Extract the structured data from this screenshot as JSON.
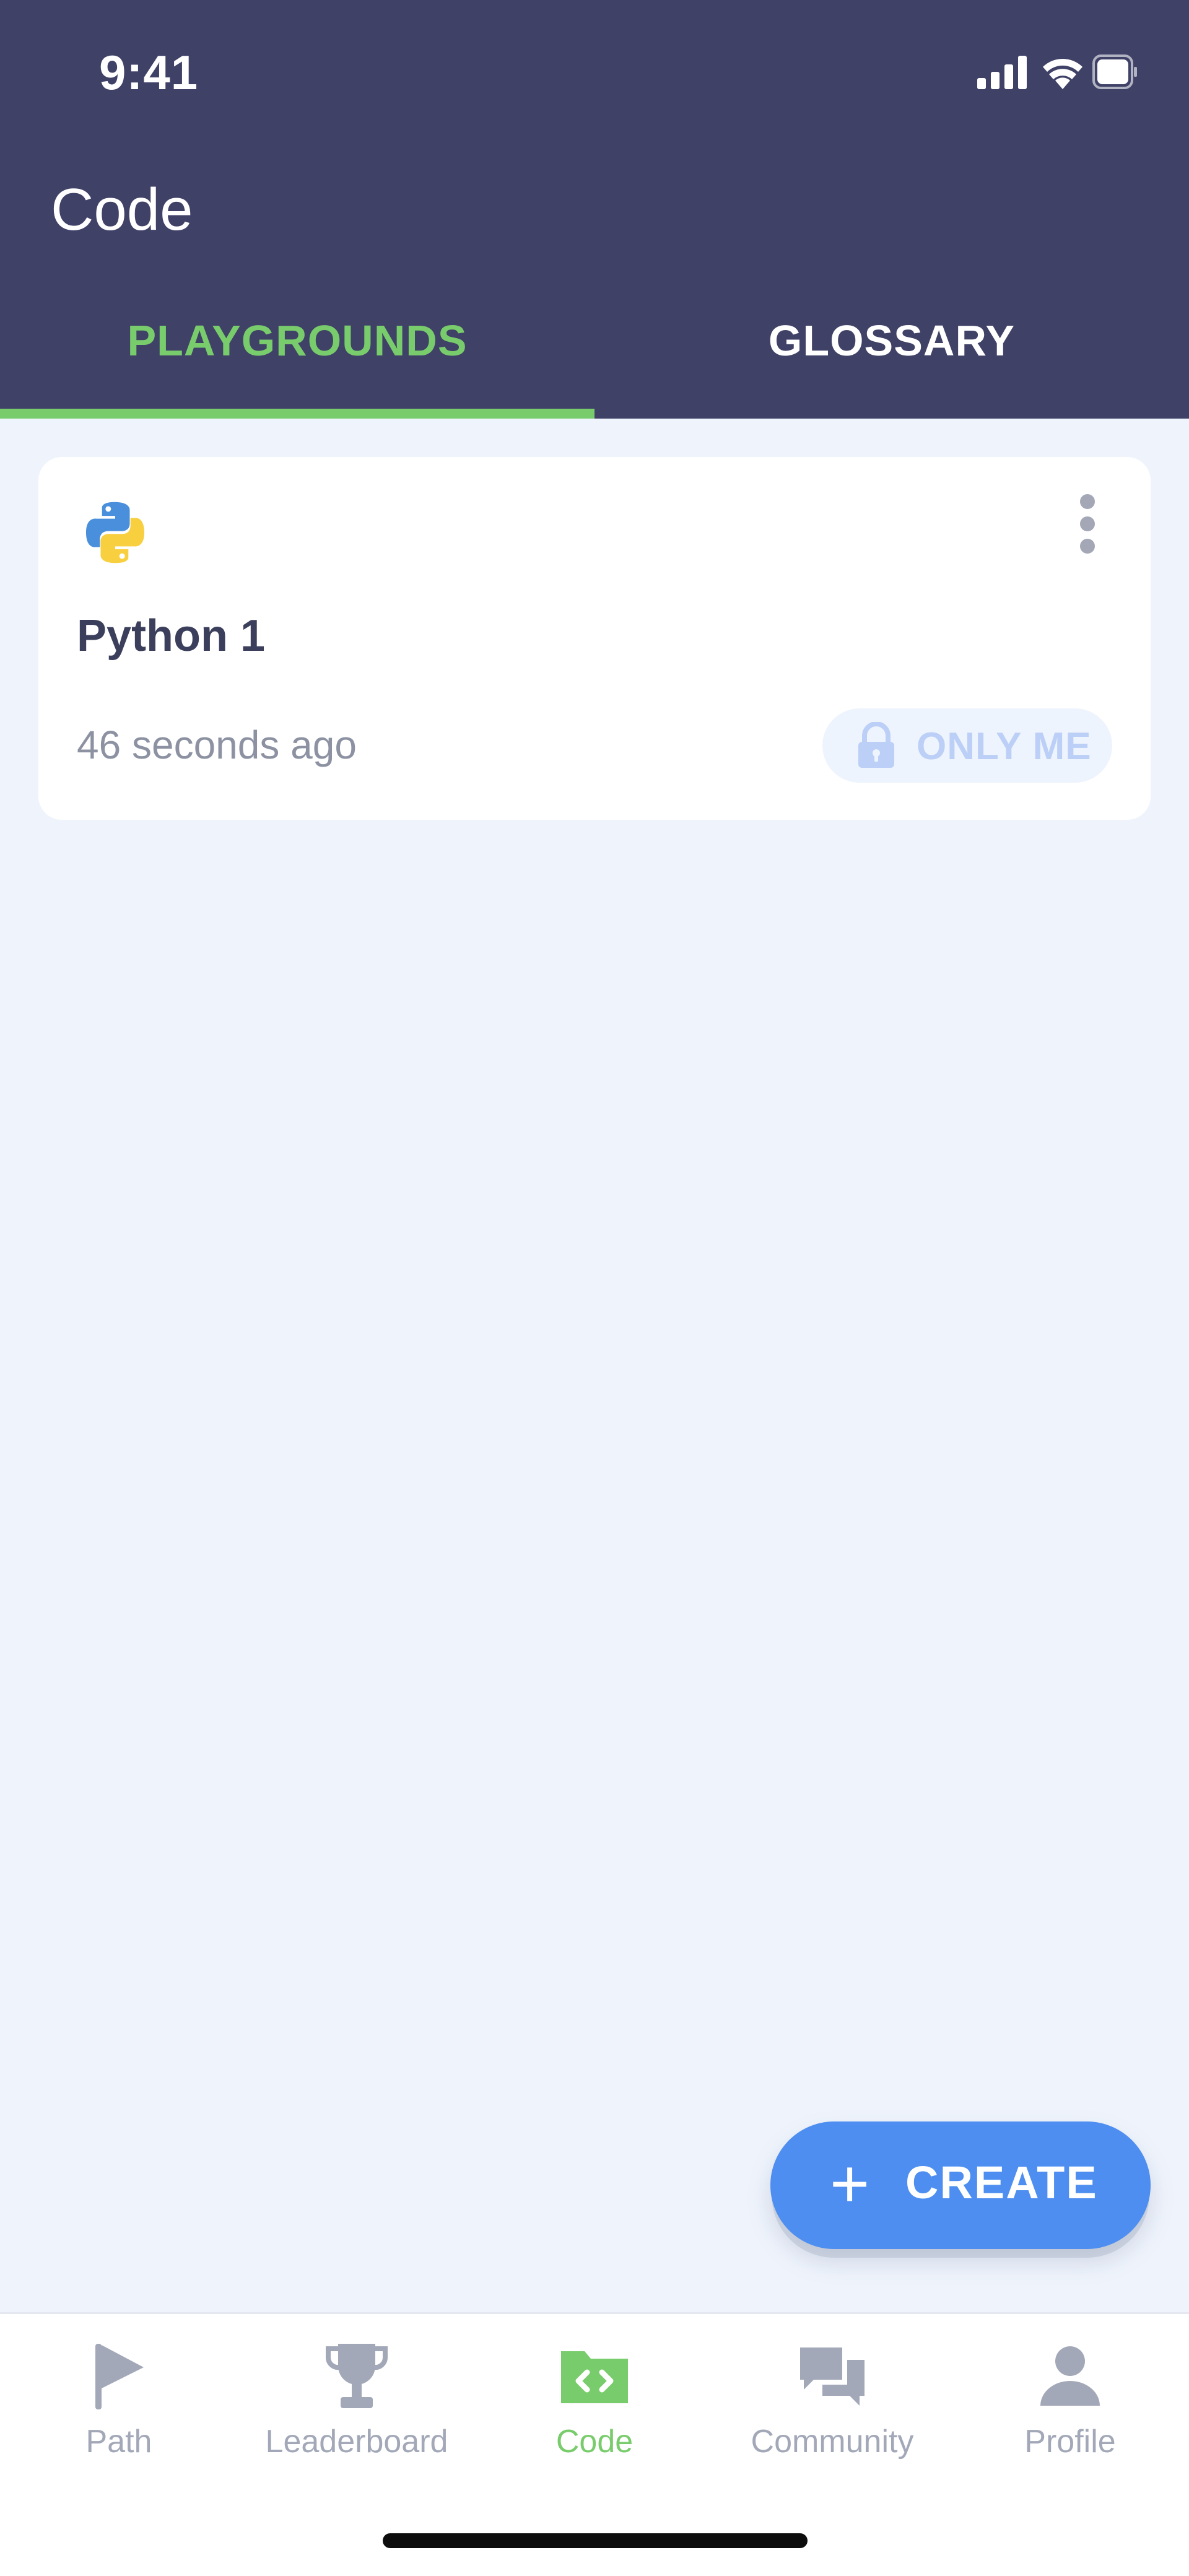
{
  "status_bar": {
    "time": "9:41",
    "icons": [
      "signal-icon",
      "wifi-icon",
      "battery-icon"
    ]
  },
  "header": {
    "title": "Code",
    "tabs": [
      {
        "label": "PLAYGROUNDS",
        "active": true
      },
      {
        "label": "GLOSSARY",
        "active": false
      }
    ]
  },
  "playgrounds": [
    {
      "language_icon": "python-icon",
      "title": "Python 1",
      "updated": "46 seconds ago",
      "privacy": "ONLY ME",
      "privacy_icon": "lock-icon"
    }
  ],
  "create_button": {
    "icon": "plus-icon",
    "label": "CREATE"
  },
  "bottom_nav": {
    "items": [
      {
        "label": "Path",
        "icon": "flag-icon",
        "active": false
      },
      {
        "label": "Leaderboard",
        "icon": "trophy-icon",
        "active": false
      },
      {
        "label": "Code",
        "icon": "code-folder-icon",
        "active": true
      },
      {
        "label": "Community",
        "icon": "chat-bubbles-icon",
        "active": false
      },
      {
        "label": "Profile",
        "icon": "person-icon",
        "active": false
      }
    ]
  },
  "colors": {
    "header_bg": "#3f4167",
    "accent_green": "#79cc6c",
    "primary_blue": "#4d8ef0",
    "page_bg": "#eff4fc",
    "inactive_gray": "#a3a8b8"
  }
}
